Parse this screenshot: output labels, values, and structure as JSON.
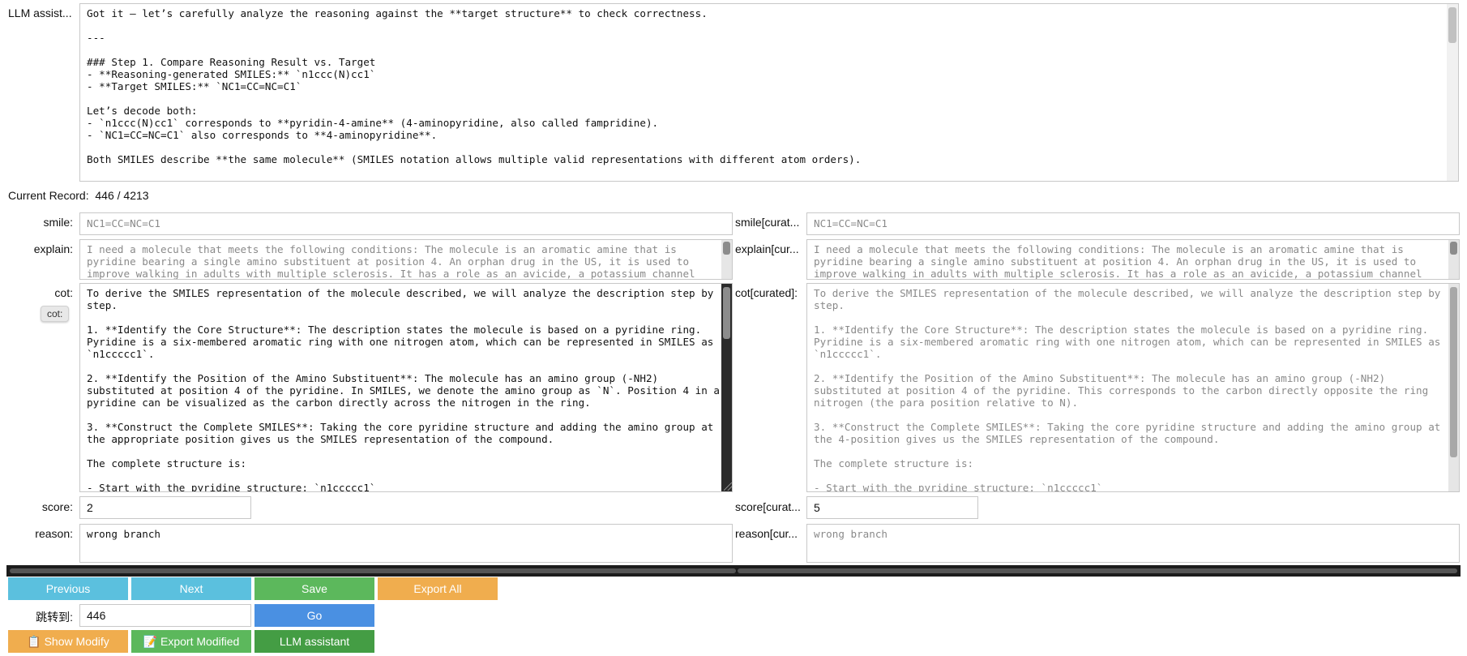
{
  "llm": {
    "label": "LLM assist...",
    "text": "Got it — let’s carefully analyze the reasoning against the **target structure** to check correctness.\n\n---\n\n### Step 1. Compare Reasoning Result vs. Target\n- **Reasoning-generated SMILES:** `n1ccc(N)cc1`\n- **Target SMILES:** `NC1=CC=NC=C1`\n\nLet’s decode both:\n- `n1ccc(N)cc1` corresponds to **pyridin-4-amine** (4-aminopyridine, also called fampridine).\n- `NC1=CC=NC=C1` also corresponds to **4-aminopyridine**.\n\nBoth SMILES describe **the same molecule** (SMILES notation allows multiple valid representations with different atom orders).\n\n-"
  },
  "record": {
    "label": "Current Record:",
    "value": "446 / 4213"
  },
  "left": {
    "smile_label": "smile:",
    "smile_value": "NC1=CC=NC=C1",
    "explain_label": "explain:",
    "explain_text": "I need a molecule that meets the following conditions: The molecule is an aromatic amine that is pyridine bearing a single amino substituent at position 4. An orphan drug in the US, it is used to improve walking in adults with multiple sclerosis. It has a role as an avicide, a potassium channel",
    "cot_label": "cot:",
    "cot_tooltip": "cot:",
    "cot_text": "To derive the SMILES representation of the molecule described, we will analyze the description step by step.\n\n1. **Identify the Core Structure**: The description states the molecule is based on a pyridine ring. Pyridine is a six-membered aromatic ring with one nitrogen atom, which can be represented in SMILES as `n1ccccc1`.\n\n2. **Identify the Position of the Amino Substituent**: The molecule has an amino group (-NH2) substituted at position 4 of the pyridine. In SMILES, we denote the amino group as `N`. Position 4 in a pyridine can be visualized as the carbon directly across the nitrogen in the ring.\n\n3. **Construct the Complete SMILES**: Taking the core pyridine structure and adding the amino group at the appropriate position gives us the SMILES representation of the compound.\n\nThe complete structure is:\n\n- Start with the pyridine structure: `n1ccccc1`",
    "score_label": "score:",
    "score_value": "2",
    "reason_label": "reason:",
    "reason_value": "wrong branch"
  },
  "right": {
    "smile_label": "smile[curat...",
    "smile_value": "NC1=CC=NC=C1",
    "explain_label": "explain[cur...",
    "explain_text": "I need a molecule that meets the following conditions: The molecule is an aromatic amine that is pyridine bearing a single amino substituent at position 4. An orphan drug in the US, it is used to improve walking in adults with multiple sclerosis. It has a role as an avicide, a potassium channel",
    "cot_label": "cot[curated]:",
    "cot_text": "To derive the SMILES representation of the molecule described, we will analyze the description step by step.\n\n1. **Identify the Core Structure**: The description states the molecule is based on a pyridine ring. Pyridine is a six-membered aromatic ring with one nitrogen atom, which can be represented in SMILES as `n1ccccc1`.\n\n2. **Identify the Position of the Amino Substituent**: The molecule has an amino group (-NH2) substituted at position 4 of the pyridine. This corresponds to the carbon directly opposite the ring nitrogen (the para position relative to N).\n\n3. **Construct the Complete SMILES**: Taking the core pyridine structure and adding the amino group at the 4-position gives us the SMILES representation of the compound.\n\nThe complete structure is:\n\n- Start with the pyridine structure: `n1ccccc1`",
    "score_label": "score[curat...",
    "score_value": "5",
    "reason_label": "reason[cur...",
    "reason_value": "wrong branch"
  },
  "buttons": {
    "previous": "Previous",
    "next": "Next",
    "save": "Save",
    "export_all": "Export All",
    "jump_label": "跳转到:",
    "jump_value": "446",
    "go": "Go",
    "show_modify": "📋 Show Modify",
    "export_modified": "📝 Export Modified",
    "llm_assistant": "LLM assistant"
  },
  "colors": {
    "blue_btn": "#5bc0de",
    "green_btn": "#5cb85c",
    "orange_btn": "#f0ad4e",
    "go_btn": "#4a90e2",
    "dark_green_btn": "#449d44"
  }
}
